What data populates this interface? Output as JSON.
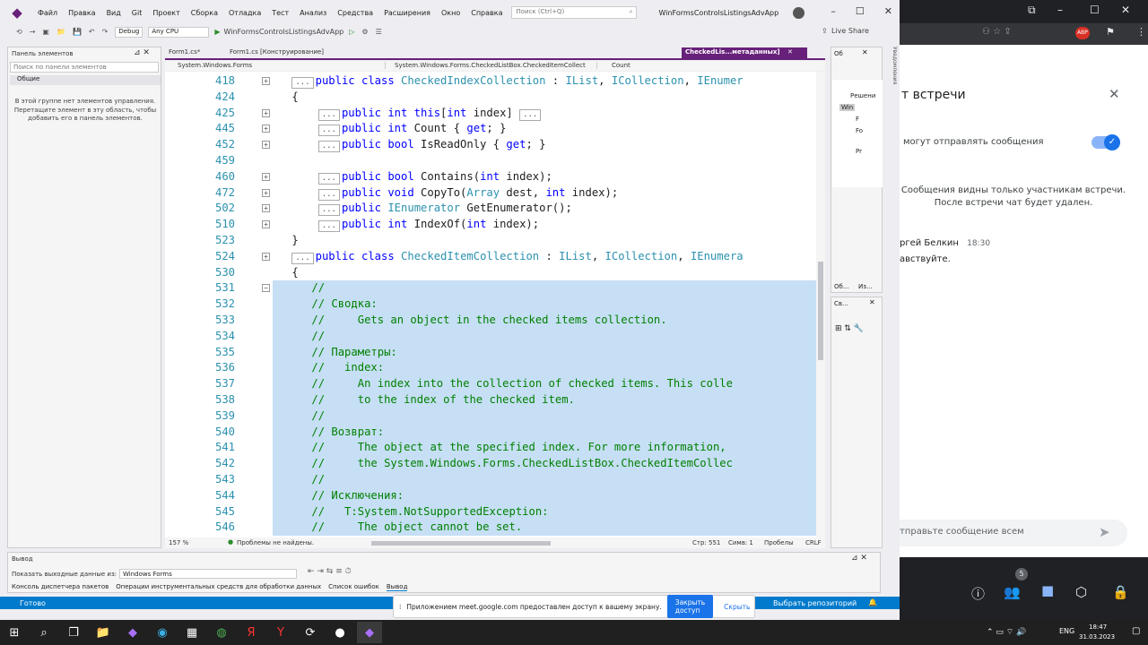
{
  "menubar": {
    "items": [
      "Файл",
      "Правка",
      "Вид",
      "Git",
      "Проект",
      "Сборка",
      "Отладка",
      "Тест",
      "Анализ",
      "Средства",
      "Расширения",
      "Окно",
      "Справка"
    ],
    "search_placeholder": "Поиск (Ctrl+Q)",
    "window_title": "WinFormsControlsListingsAdvApp"
  },
  "toolbar": {
    "config": "Debug",
    "platform": "Any CPU",
    "run_label": "WinFormsControlsListingsAdvApp",
    "live_share": "Live Share"
  },
  "toolbox": {
    "title": "Панель элементов",
    "search_placeholder": "Поиск по панели элементов",
    "group": "Общие",
    "empty_text": "В этой группе нет элементов управления. Перетащите элемент в эту область, чтобы добавить его в панель элементов."
  },
  "doc_tabs": {
    "tab1": "Form1.cs*",
    "tab2": "Form1.cs [Конструирование]",
    "active": "CheckedLis...метаданных]"
  },
  "nav_bar": {
    "left": "System.Windows.Forms",
    "middle": "System.Windows.Forms.CheckedListBox.CheckedItemCollect",
    "right": "Count"
  },
  "code_lines": [
    {
      "n": "418",
      "html": "<span class=\"collapsed\">...</span><span class=\"kw\">public class</span> <span class=\"ty\">CheckedIndexCollection</span> : <span class=\"ty\">IList</span>, <span class=\"ty\">ICollection</span>, <span class=\"ty\">IEnumer</span>",
      "indent": "    ",
      "sel": false,
      "box": "+"
    },
    {
      "n": "424",
      "html": "{",
      "indent": "    ",
      "sel": false,
      "box": ""
    },
    {
      "n": "425",
      "html": "<span class=\"collapsed\">...</span><span class=\"kw\">public int this</span>[<span class=\"kw\">int</span> index] <span class=\"collapsed\">...</span>",
      "indent": "        ",
      "sel": false,
      "box": "+"
    },
    {
      "n": "445",
      "html": "<span class=\"collapsed\">...</span><span class=\"kw\">public int</span> Count { <span class=\"kw\">get</span>; }",
      "indent": "        ",
      "sel": false,
      "box": "+"
    },
    {
      "n": "452",
      "html": "<span class=\"collapsed\">...</span><span class=\"kw\">public bool</span> IsReadOnly { <span class=\"kw\">get</span>; }",
      "indent": "        ",
      "sel": false,
      "box": "+"
    },
    {
      "n": "459",
      "html": "",
      "indent": "",
      "sel": false,
      "box": ""
    },
    {
      "n": "460",
      "html": "<span class=\"collapsed\">...</span><span class=\"kw\">public bool</span> Contains(<span class=\"kw\">int</span> index);",
      "indent": "        ",
      "sel": false,
      "box": "+"
    },
    {
      "n": "472",
      "html": "<span class=\"collapsed\">...</span><span class=\"kw\">public void</span> CopyTo(<span class=\"ty\">Array</span> dest, <span class=\"kw\">int</span> index);",
      "indent": "        ",
      "sel": false,
      "box": "+"
    },
    {
      "n": "502",
      "html": "<span class=\"collapsed\">...</span><span class=\"kw\">public</span> <span class=\"ty\">IEnumerator</span> GetEnumerator();",
      "indent": "        ",
      "sel": false,
      "box": "+"
    },
    {
      "n": "510",
      "html": "<span class=\"collapsed\">...</span><span class=\"kw\">public int</span> IndexOf(<span class=\"kw\">int</span> index);",
      "indent": "        ",
      "sel": false,
      "box": "+"
    },
    {
      "n": "523",
      "html": "}",
      "indent": "    ",
      "sel": false,
      "box": ""
    },
    {
      "n": "524",
      "html": "<span class=\"collapsed\">...</span><span class=\"kw\">public class</span> <span class=\"ty\">CheckedItemCollection</span> : <span class=\"ty\">IList</span>, <span class=\"ty\">ICollection</span>, <span class=\"ty\">IEnumera</span>",
      "indent": "    ",
      "sel": false,
      "box": "+"
    },
    {
      "n": "530",
      "html": "{",
      "indent": "    ",
      "sel": false,
      "box": ""
    },
    {
      "n": "531",
      "html": "<span class=\"cm\">//</span>",
      "indent": "       ",
      "sel": true,
      "box": "-"
    },
    {
      "n": "532",
      "html": "<span class=\"cm\">// Сводка:</span>",
      "indent": "       ",
      "sel": true,
      "box": ""
    },
    {
      "n": "533",
      "html": "<span class=\"cm\">//     Gets an object in the checked items collection.</span>",
      "indent": "       ",
      "sel": true,
      "box": ""
    },
    {
      "n": "534",
      "html": "<span class=\"cm\">//</span>",
      "indent": "       ",
      "sel": true,
      "box": ""
    },
    {
      "n": "535",
      "html": "<span class=\"cm\">// Параметры:</span>",
      "indent": "       ",
      "sel": true,
      "box": ""
    },
    {
      "n": "536",
      "html": "<span class=\"cm\">//   index:</span>",
      "indent": "       ",
      "sel": true,
      "box": ""
    },
    {
      "n": "537",
      "html": "<span class=\"cm\">//     An index into the collection of checked items. This colle</span>",
      "indent": "       ",
      "sel": true,
      "box": ""
    },
    {
      "n": "538",
      "html": "<span class=\"cm\">//     to the index of the checked item.</span>",
      "indent": "       ",
      "sel": true,
      "box": ""
    },
    {
      "n": "539",
      "html": "<span class=\"cm\">//</span>",
      "indent": "       ",
      "sel": true,
      "box": ""
    },
    {
      "n": "540",
      "html": "<span class=\"cm\">// Возврат:</span>",
      "indent": "       ",
      "sel": true,
      "box": ""
    },
    {
      "n": "541",
      "html": "<span class=\"cm\">//     The object at the specified index. For more information,</span>",
      "indent": "       ",
      "sel": true,
      "box": ""
    },
    {
      "n": "542",
      "html": "<span class=\"cm\">//     the System.Windows.Forms.CheckedListBox.CheckedItemCollec</span>",
      "indent": "       ",
      "sel": true,
      "box": ""
    },
    {
      "n": "543",
      "html": "<span class=\"cm\">//</span>",
      "indent": "       ",
      "sel": true,
      "box": ""
    },
    {
      "n": "544",
      "html": "<span class=\"cm\">// Исключения:</span>",
      "indent": "       ",
      "sel": true,
      "box": ""
    },
    {
      "n": "545",
      "html": "<span class=\"cm\">//   T:System.NotSupportedException:</span>",
      "indent": "       ",
      "sel": true,
      "box": ""
    },
    {
      "n": "546",
      "html": "<span class=\"cm\">//     The object cannot be set.</span>",
      "indent": "       ",
      "sel": true,
      "box": ""
    }
  ],
  "editor_status": {
    "zoom": "157 %",
    "problems": "Проблемы не найдены.",
    "line": "Стр: 551",
    "char": "Симв: 1",
    "spaces": "Пробелы",
    "eol": "CRLF"
  },
  "right_panel": {
    "tab1": "Об",
    "solution": "Решени",
    "item1": "Win",
    "item2": "F",
    "item3": "Fo",
    "item4": "Pr",
    "tab_ob": "Об...",
    "tab_iz": "Из...",
    "props_tab": "Св..."
  },
  "output": {
    "title": "Вывод",
    "show_from": "Показать выходные данные из:",
    "source": "Windows Forms",
    "bottom_tabs": [
      "Консоль диспетчера пакетов",
      "Операции инструментальных средств для обработки данных",
      "Список ошибок",
      "Вывод"
    ]
  },
  "status_bar": {
    "ready": "Готово",
    "repo": "Выбрать репозиторий"
  },
  "share_bar": {
    "text": "Приложением meet.google.com предоставлен доступ к вашему экрану.",
    "stop": "Закрыть доступ",
    "hide": "Скрыть"
  },
  "meet": {
    "title": "т встречи",
    "toggle_label": "могут отправлять сообщения",
    "info": "Сообщения видны только участникам встречи. После встречи чат будет удален.",
    "sender": "ргей Белкин",
    "time": "18:30",
    "message": "авствуйте.",
    "input_placeholder": "тправьте сообщение всем",
    "participants_count": "5",
    "accent": "#8ab4f8"
  },
  "taskbar": {
    "lang": "ENG",
    "time": "18:47",
    "date": "31.03.2023"
  }
}
